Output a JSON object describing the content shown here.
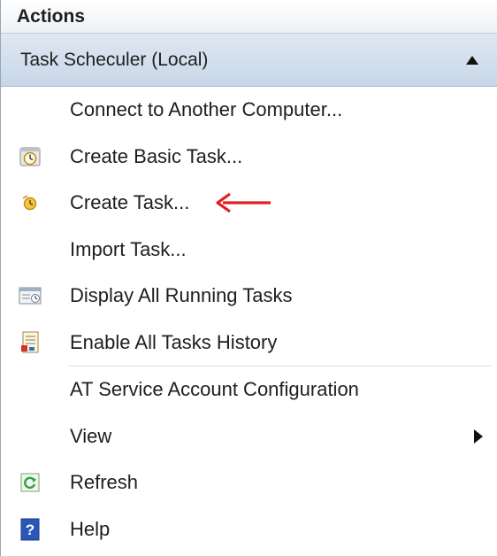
{
  "panel": {
    "title": "Actions"
  },
  "section": {
    "title": "Task Scheculer (Local)",
    "toggle_icon": "collapse-up-triangle-icon"
  },
  "items": [
    {
      "label": "Connect to Another Computer...",
      "icon": "none"
    },
    {
      "label": "Create Basic Task...",
      "icon": "basic-task-clock-icon"
    },
    {
      "label": "Create Task...",
      "icon": "create-task-clock-icon"
    },
    {
      "label": "Import Task...",
      "icon": "none"
    },
    {
      "label": "Display All Running Tasks",
      "icon": "running-tasks-icon"
    },
    {
      "label": "Enable All Tasks History",
      "icon": "task-history-icon"
    },
    {
      "label": "AT Service Account Configuration",
      "icon": "none"
    },
    {
      "label": "View",
      "icon": "none",
      "submenu_icon": "submenu-arrow-icon"
    },
    {
      "label": "Refresh",
      "icon": "refresh-icon"
    },
    {
      "label": "Help",
      "icon": "help-icon"
    }
  ],
  "annotation": {
    "icon": "red-left-arrow-icon",
    "color": "#e0201c"
  },
  "colors": {
    "section_header_bg": "#c8d7e8",
    "help_icon_bg": "#2b56b8",
    "refresh_icon_green": "#2ea043"
  }
}
